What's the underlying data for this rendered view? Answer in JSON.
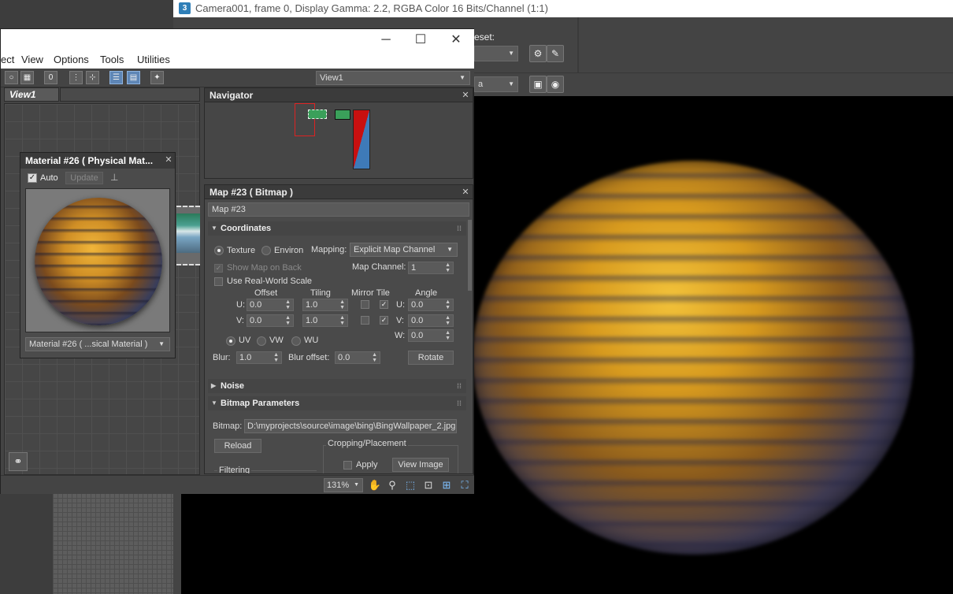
{
  "render_window": {
    "title": "Camera001, frame 0, Display Gamma: 2.2, RGBA Color 16 Bits/Channel (1:1)",
    "app_icon": "3",
    "preset_label_partial": "eset:",
    "dropdown_partial": "a"
  },
  "editor": {
    "menu": [
      "ect",
      "View",
      "Options",
      "Tools",
      "Utilities"
    ],
    "view_select": "View1",
    "view_tab": "View1"
  },
  "material_node": {
    "title": "Material #26  ( Physical Mat...",
    "auto_label": "Auto",
    "update_label": "Update",
    "select_value": "Material #26  ( ...sical Material )"
  },
  "navigator": {
    "title": "Navigator"
  },
  "map_panel": {
    "title": "Map #23  ( Bitmap )",
    "name_value": "Map #23",
    "coordinates": {
      "rollout": "Coordinates",
      "texture": "Texture",
      "environ": "Environ",
      "mapping_label": "Mapping:",
      "mapping_value": "Explicit Map Channel",
      "show_map_on_back": "Show Map on Back",
      "map_channel_label": "Map Channel:",
      "map_channel_value": "1",
      "use_real_world": "Use Real-World Scale",
      "offset_header": "Offset",
      "tiling_header": "Tiling",
      "mirror_tile_header": "Mirror Tile",
      "angle_header": "Angle",
      "u_label": "U:",
      "v_label": "V:",
      "w_label": "W:",
      "offset_u": "0.0",
      "offset_v": "0.0",
      "tiling_u": "1.0",
      "tiling_v": "1.0",
      "angle_u": "0.0",
      "angle_v": "0.0",
      "angle_w": "0.0",
      "uv": "UV",
      "vw": "VW",
      "wu": "WU",
      "blur_label": "Blur:",
      "blur_value": "1.0",
      "blur_offset_label": "Blur offset:",
      "blur_offset_value": "0.0",
      "rotate": "Rotate"
    },
    "noise_rollout": "Noise",
    "bitmap_params": {
      "rollout": "Bitmap Parameters",
      "bitmap_label": "Bitmap:",
      "bitmap_path": "D:\\myprojects\\source\\image\\bing\\BingWallpaper_2.jpg",
      "reload": "Reload",
      "cropping_label": "Cropping/Placement",
      "apply": "Apply",
      "view_image": "View Image",
      "filtering": "Filtering"
    }
  },
  "status": {
    "zoom": "131%"
  }
}
